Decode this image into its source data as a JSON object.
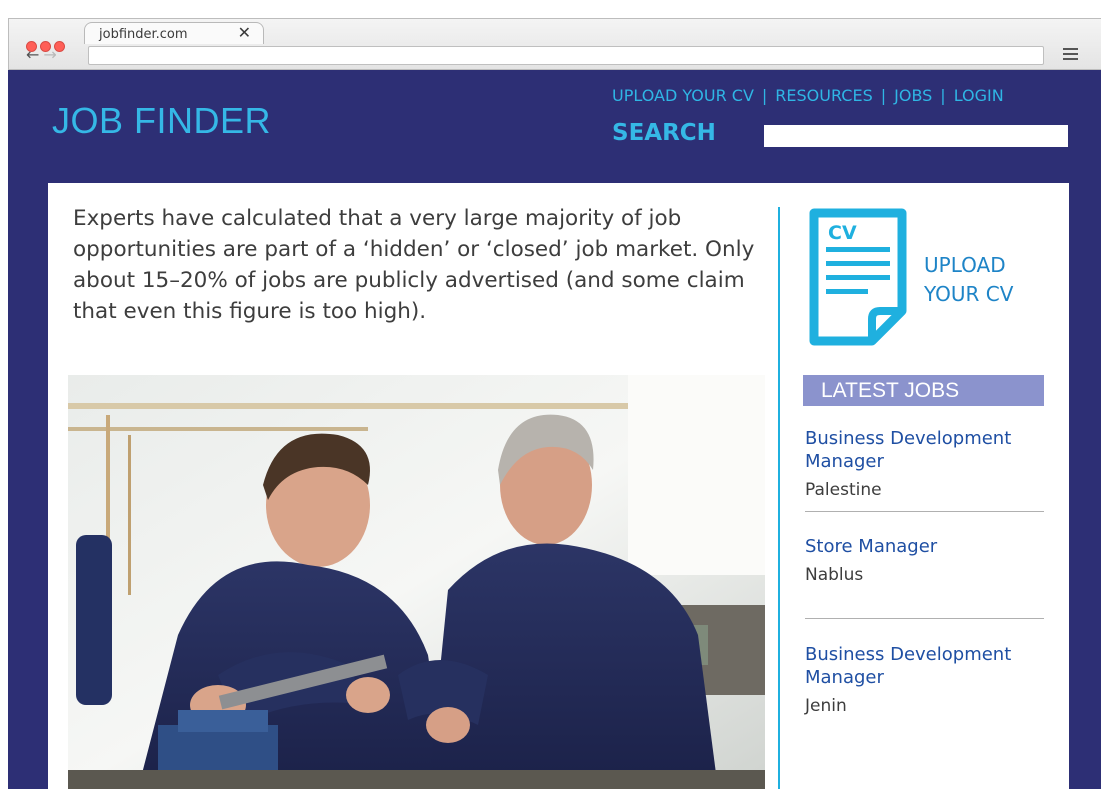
{
  "browser": {
    "tab_title": "jobfinder.com",
    "tab_close": "✕",
    "back": "←",
    "forward": "→"
  },
  "site": {
    "logo": "JOB FINDER",
    "nav": [
      "UPLOAD YOUR CV",
      "RESOURCES",
      "JOBS",
      "LOGIN"
    ],
    "nav_separator": "|",
    "search_label": "SEARCH",
    "search_value": ""
  },
  "main": {
    "intro": "Experts have calculated that a very large majority of job opportunities are part of a ‘hidden’ or ‘closed’ job market. Only about 15–20% of jobs are publicly advertised (and some claim that even this figure is too high).",
    "photo_icon": "workshop-photo"
  },
  "sidebar": {
    "cv_icon_label": "CV",
    "upload_cv": "UPLOAD YOUR CV",
    "latest_jobs_title": "LATEST JOBS",
    "jobs": [
      {
        "title": "Business Development Manager",
        "location": "Palestine"
      },
      {
        "title": "Store Manager",
        "location": "Nablus"
      },
      {
        "title": "Business Development Manager",
        "location": "Jenin"
      }
    ]
  },
  "colors": {
    "site_bg": "#2d2f75",
    "accent_blue": "#35b8e6",
    "latest_header": "#8b93cd",
    "job_title": "#1f4fa3"
  }
}
